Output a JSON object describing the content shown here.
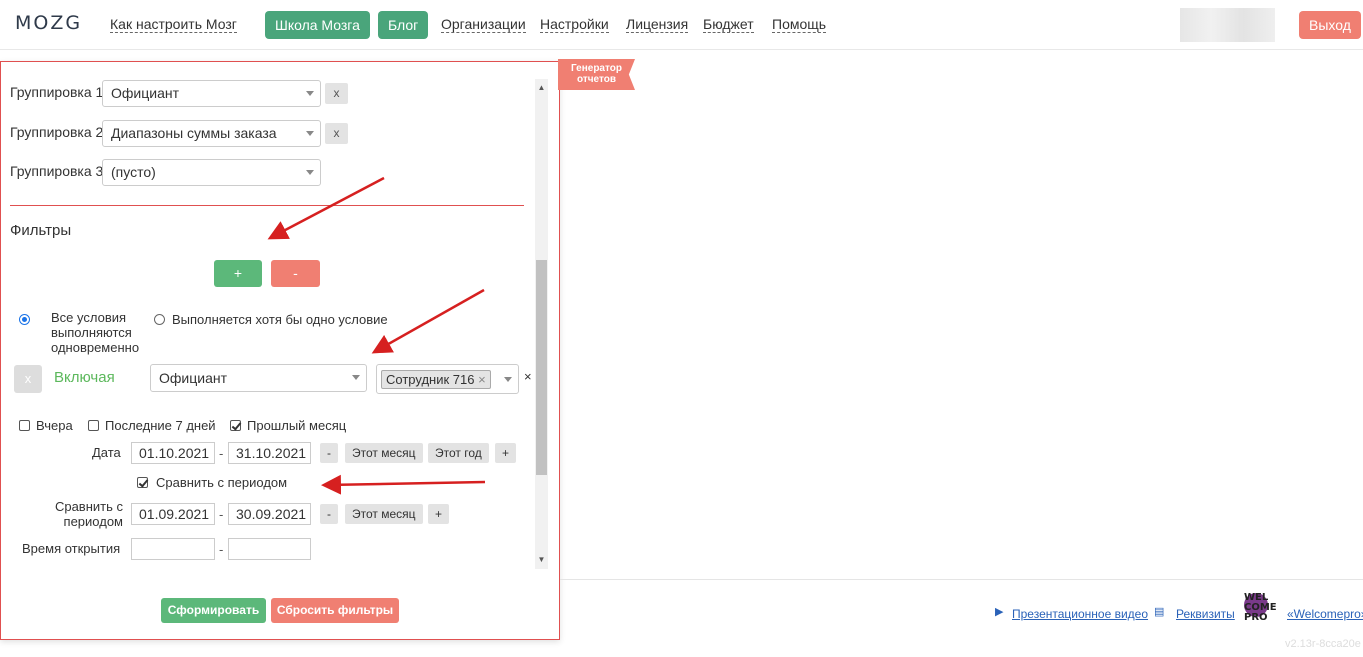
{
  "header": {
    "logo": "MOZG",
    "nav": {
      "how_to": "Как настроить Мозг",
      "school": "Школа Мозга",
      "blog": "Блог",
      "organizations": "Организации",
      "settings": "Настройки",
      "license": "Лицензия",
      "budget": "Бюджет",
      "help": "Помощь"
    },
    "logout": "Выход"
  },
  "ribbon": "Генератор отчетов",
  "groupings": [
    {
      "label": "Группировка 1",
      "value": "Официант"
    },
    {
      "label": "Группировка 2",
      "value": "Диапазоны суммы заказа"
    },
    {
      "label": "Группировка 3",
      "value": "(пусто)"
    }
  ],
  "remove_x": "x",
  "filters": {
    "title": "Фильтры",
    "add": "+",
    "remove": "-",
    "mode_all": "Все условия выполняются одновременно",
    "mode_any": "Выполняется хотя бы одно условие",
    "condition": {
      "remove": "x",
      "include": "Включая",
      "field": "Официант",
      "tag": "Сотрудник 716",
      "tag_remove": "×",
      "clear": "×"
    }
  },
  "period": {
    "yesterday": "Вчера",
    "last7": "Последние 7 дней",
    "last_month": "Прошлый месяц",
    "date_label": "Дата",
    "date_from": "01.10.2021",
    "date_to": "31.10.2021",
    "minus": "-",
    "this_month": "Этот месяц",
    "this_year": "Этот год",
    "plus": "+",
    "compare_checkbox": "Сравнить с периодом",
    "compare_label": "Сравнить с периодом",
    "compare_from": "01.09.2021",
    "compare_to": "30.09.2021",
    "open_time_label": "Время открытия",
    "range_sep": "-"
  },
  "actions": {
    "generate": "Сформировать",
    "reset": "Сбросить фильтры"
  },
  "footer": {
    "video": "Презентационное видео",
    "requisites": "Реквизиты",
    "partner_logo": "WEL COME PRO",
    "partner": "«Welcomepro»",
    "version": "v2.13r-8cca20e"
  },
  "colors": {
    "green": "#4aa57b",
    "red": "#f07f72",
    "panel_border": "#e05050",
    "link": "#2a62b8"
  }
}
